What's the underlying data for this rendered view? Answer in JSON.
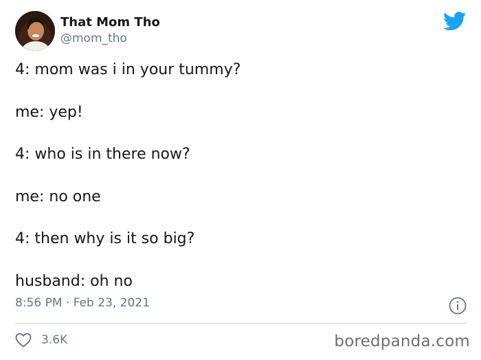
{
  "tweet": {
    "author": {
      "display_name": "That Mom Tho",
      "handle": "@mom_tho",
      "avatar_icon": "user-avatar-photo"
    },
    "lines": [
      "4: mom was i in your tummy?",
      "me: yep!",
      "4: who is in there now?",
      "me: no one",
      "4: then why is it so big?",
      "husband: oh no"
    ],
    "timestamp": "8:56 PM · Feb 23, 2021",
    "likes": "3.6K"
  },
  "icons": {
    "brand": "twitter-bird-icon",
    "info": "info-icon",
    "like": "heart-icon"
  },
  "watermark": "boredpanda.com",
  "colors": {
    "twitter_blue": "#1da1f2",
    "text": "#14171a",
    "secondary_text": "#657786",
    "divider": "#ccd6dd"
  }
}
